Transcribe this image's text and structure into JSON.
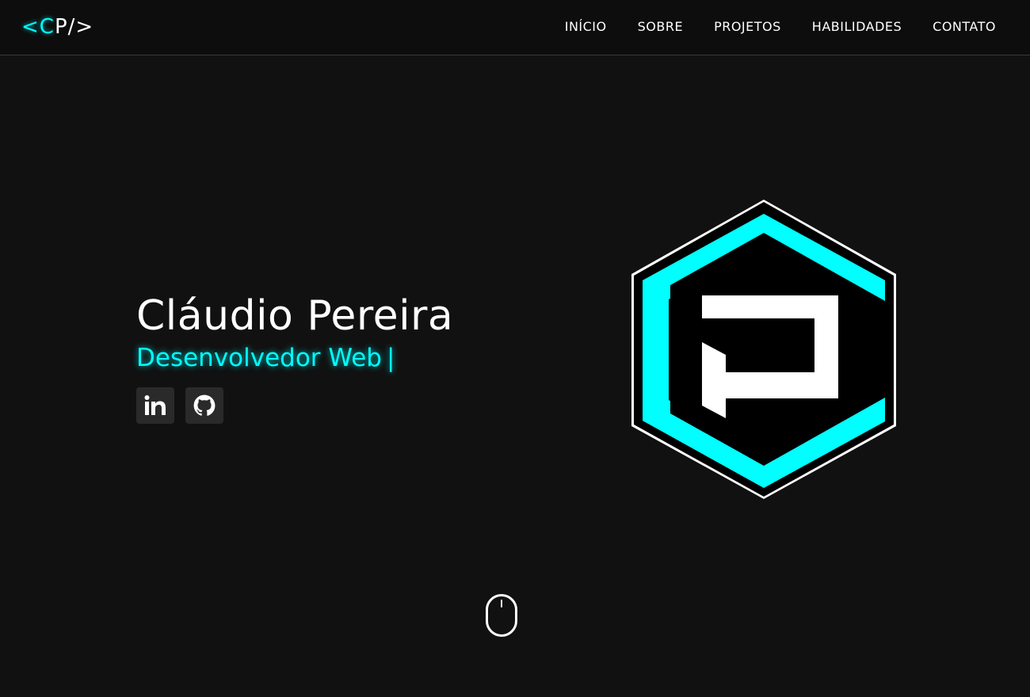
{
  "logo": {
    "lt": "<",
    "c": "C",
    "p": "P",
    "end": "/>"
  },
  "nav": {
    "items": [
      {
        "label": "INÍCIO"
      },
      {
        "label": "SOBRE"
      },
      {
        "label": "PROJETOS"
      },
      {
        "label": "HABILIDADES"
      },
      {
        "label": "CONTATO"
      }
    ]
  },
  "hero": {
    "name": "Cláudio Pereira",
    "role": "Desenvolvedor Web",
    "caret": "|"
  },
  "socials": {
    "linkedin_icon": "linkedin-icon",
    "github_icon": "github-icon"
  },
  "colors": {
    "accent": "#00ffff",
    "background": "#111111",
    "header": "#0d0d0d",
    "button": "#2a2a2a"
  },
  "icons": {
    "brand": "cp-hexagon-logo",
    "scroll": "mouse-scroll-icon"
  }
}
